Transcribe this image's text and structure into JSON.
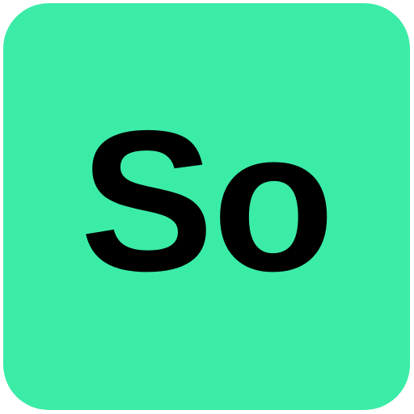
{
  "app_icon": {
    "label": "So",
    "background_color": "#3BECA6",
    "text_color": "#000000"
  }
}
